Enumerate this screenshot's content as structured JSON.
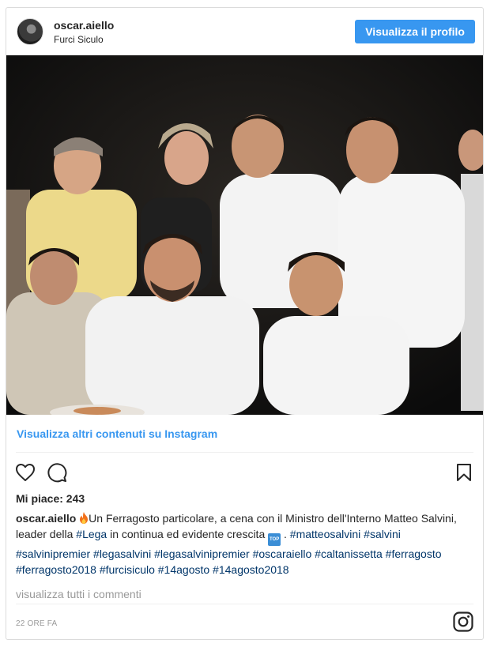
{
  "post": {
    "username": "oscar.aiello",
    "location": "Furci Siculo",
    "view_profile_label": "Visualizza il profilo",
    "more_content_label": "Visualizza altri contenuti su Instagram",
    "likes_label": "Mi piace: 243",
    "caption": {
      "username": "oscar.aiello",
      "text_1": "Un Ferragosto particolare, a cena con il Ministro dell'Interno Matteo Salvini, leader della ",
      "tag_lega": "#Lega",
      "text_2": " in continua ed evidente crescita ",
      "top_emoji": "TOP",
      "text_3": " . ",
      "hashtags": "#matteosalvini #salvini #salvinipremier #legasalvini #legasalvinipremier #oscaraiello #caltanissetta #ferragosto #ferragosto2018 #furcisiculo #14agosto #14agosto2018"
    },
    "view_comments_label": "visualizza tutti i commenti",
    "timestamp": "22 ORE FA"
  },
  "icons": {
    "heart": "heart-icon",
    "comment": "comment-icon",
    "bookmark": "bookmark-icon",
    "instagram": "instagram-logo-icon",
    "flame": "fire-emoji-icon"
  },
  "colors": {
    "accent": "#3897f0",
    "hashtag": "#003569",
    "muted": "#999999",
    "border": "#dbdbdb"
  }
}
